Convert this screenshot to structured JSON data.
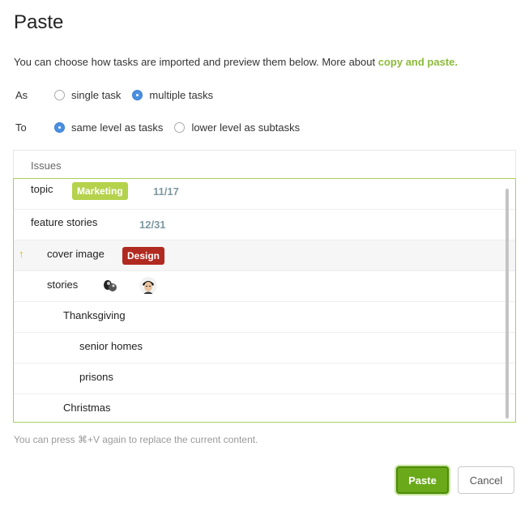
{
  "dialog": {
    "title": "Paste",
    "intro_text": "You can choose how tasks are imported and preview them below. More about ",
    "intro_link": "copy and paste."
  },
  "options": {
    "as": {
      "label": "As",
      "choices": [
        {
          "label": "single task",
          "checked": false
        },
        {
          "label": "multiple tasks",
          "checked": true
        }
      ]
    },
    "to": {
      "label": "To",
      "choices": [
        {
          "label": "same level as tasks",
          "checked": true
        },
        {
          "label": "lower level as subtasks",
          "checked": false
        }
      ]
    }
  },
  "panel": {
    "header": "Issues",
    "rows": [
      {
        "name": "topic",
        "tag": "Marketing",
        "count": "11/17"
      },
      {
        "name": "feature stories",
        "count": "12/31"
      },
      {
        "name": "cover image",
        "tag": "Design"
      },
      {
        "name": "stories"
      },
      {
        "name": "Thanksgiving"
      },
      {
        "name": "senior homes"
      },
      {
        "name": "prisons"
      },
      {
        "name": "Christmas"
      }
    ]
  },
  "hint": "You can press ⌘+V again to replace the current content.",
  "buttons": {
    "paste": "Paste",
    "cancel": "Cancel"
  },
  "colors": {
    "accent_green": "#8bbb39",
    "tag_marketing": "#b5d24c",
    "tag_design": "#b02a20",
    "primary_button": "#6aaa1a",
    "radio_checked": "#4a90e2"
  },
  "icons": {
    "move_up": "arrow-up-icon"
  }
}
